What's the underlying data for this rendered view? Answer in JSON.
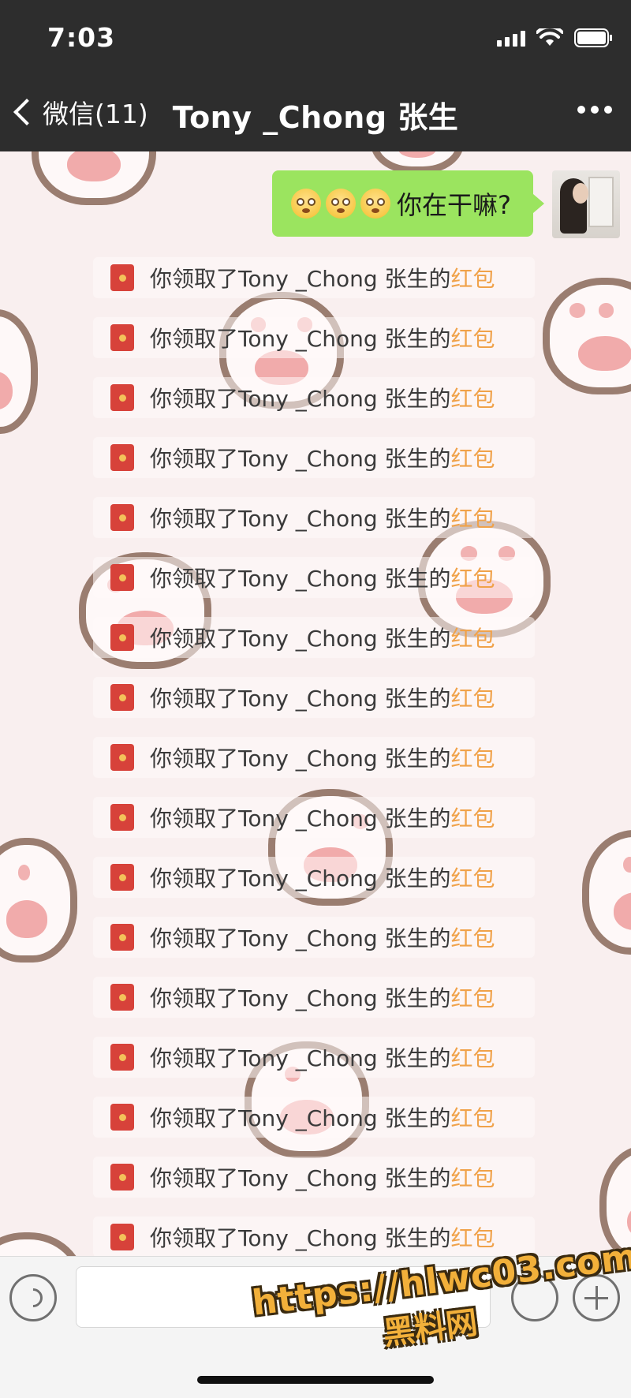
{
  "status_bar": {
    "time": "7:03"
  },
  "nav": {
    "back_label": "微信(11)",
    "title": "Tony _Chong 张生"
  },
  "message": {
    "emojis": [
      "dizzy-face",
      "dizzy-face",
      "dizzy-face"
    ],
    "text": "你在干嘛?"
  },
  "notices": [
    {
      "text": "你领取了Tony _Chong 张生的",
      "link": "红包"
    },
    {
      "text": "你领取了Tony _Chong 张生的",
      "link": "红包"
    },
    {
      "text": "你领取了Tony _Chong 张生的",
      "link": "红包"
    },
    {
      "text": "你领取了Tony _Chong 张生的",
      "link": "红包"
    },
    {
      "text": "你领取了Tony _Chong 张生的",
      "link": "红包"
    },
    {
      "text": "你领取了Tony _Chong 张生的",
      "link": "红包"
    },
    {
      "text": "你领取了Tony _Chong 张生的",
      "link": "红包"
    },
    {
      "text": "你领取了Tony _Chong 张生的",
      "link": "红包"
    },
    {
      "text": "你领取了Tony _Chong 张生的",
      "link": "红包"
    },
    {
      "text": "你领取了Tony _Chong 张生的",
      "link": "红包"
    },
    {
      "text": "你领取了Tony _Chong 张生的",
      "link": "红包"
    },
    {
      "text": "你领取了Tony _Chong 张生的",
      "link": "红包"
    },
    {
      "text": "你领取了Tony _Chong 张生的",
      "link": "红包"
    },
    {
      "text": "你领取了Tony _Chong 张生的",
      "link": "红包"
    },
    {
      "text": "你领取了Tony _Chong 张生的",
      "link": "红包"
    },
    {
      "text": "你领取了Tony _Chong 张生的",
      "link": "红包"
    },
    {
      "text": "你领取了Tony _Chong 张生的",
      "link": "红包"
    }
  ],
  "input_bar": {
    "message_value": ""
  },
  "watermark": {
    "url": "https://hlwc03.com",
    "name": "黑料网"
  },
  "colors": {
    "nav_background": "#2d2d2d",
    "bubble_green": "#9be45f",
    "red_packet": "#d7423a",
    "link_orange": "#f0a24a"
  }
}
